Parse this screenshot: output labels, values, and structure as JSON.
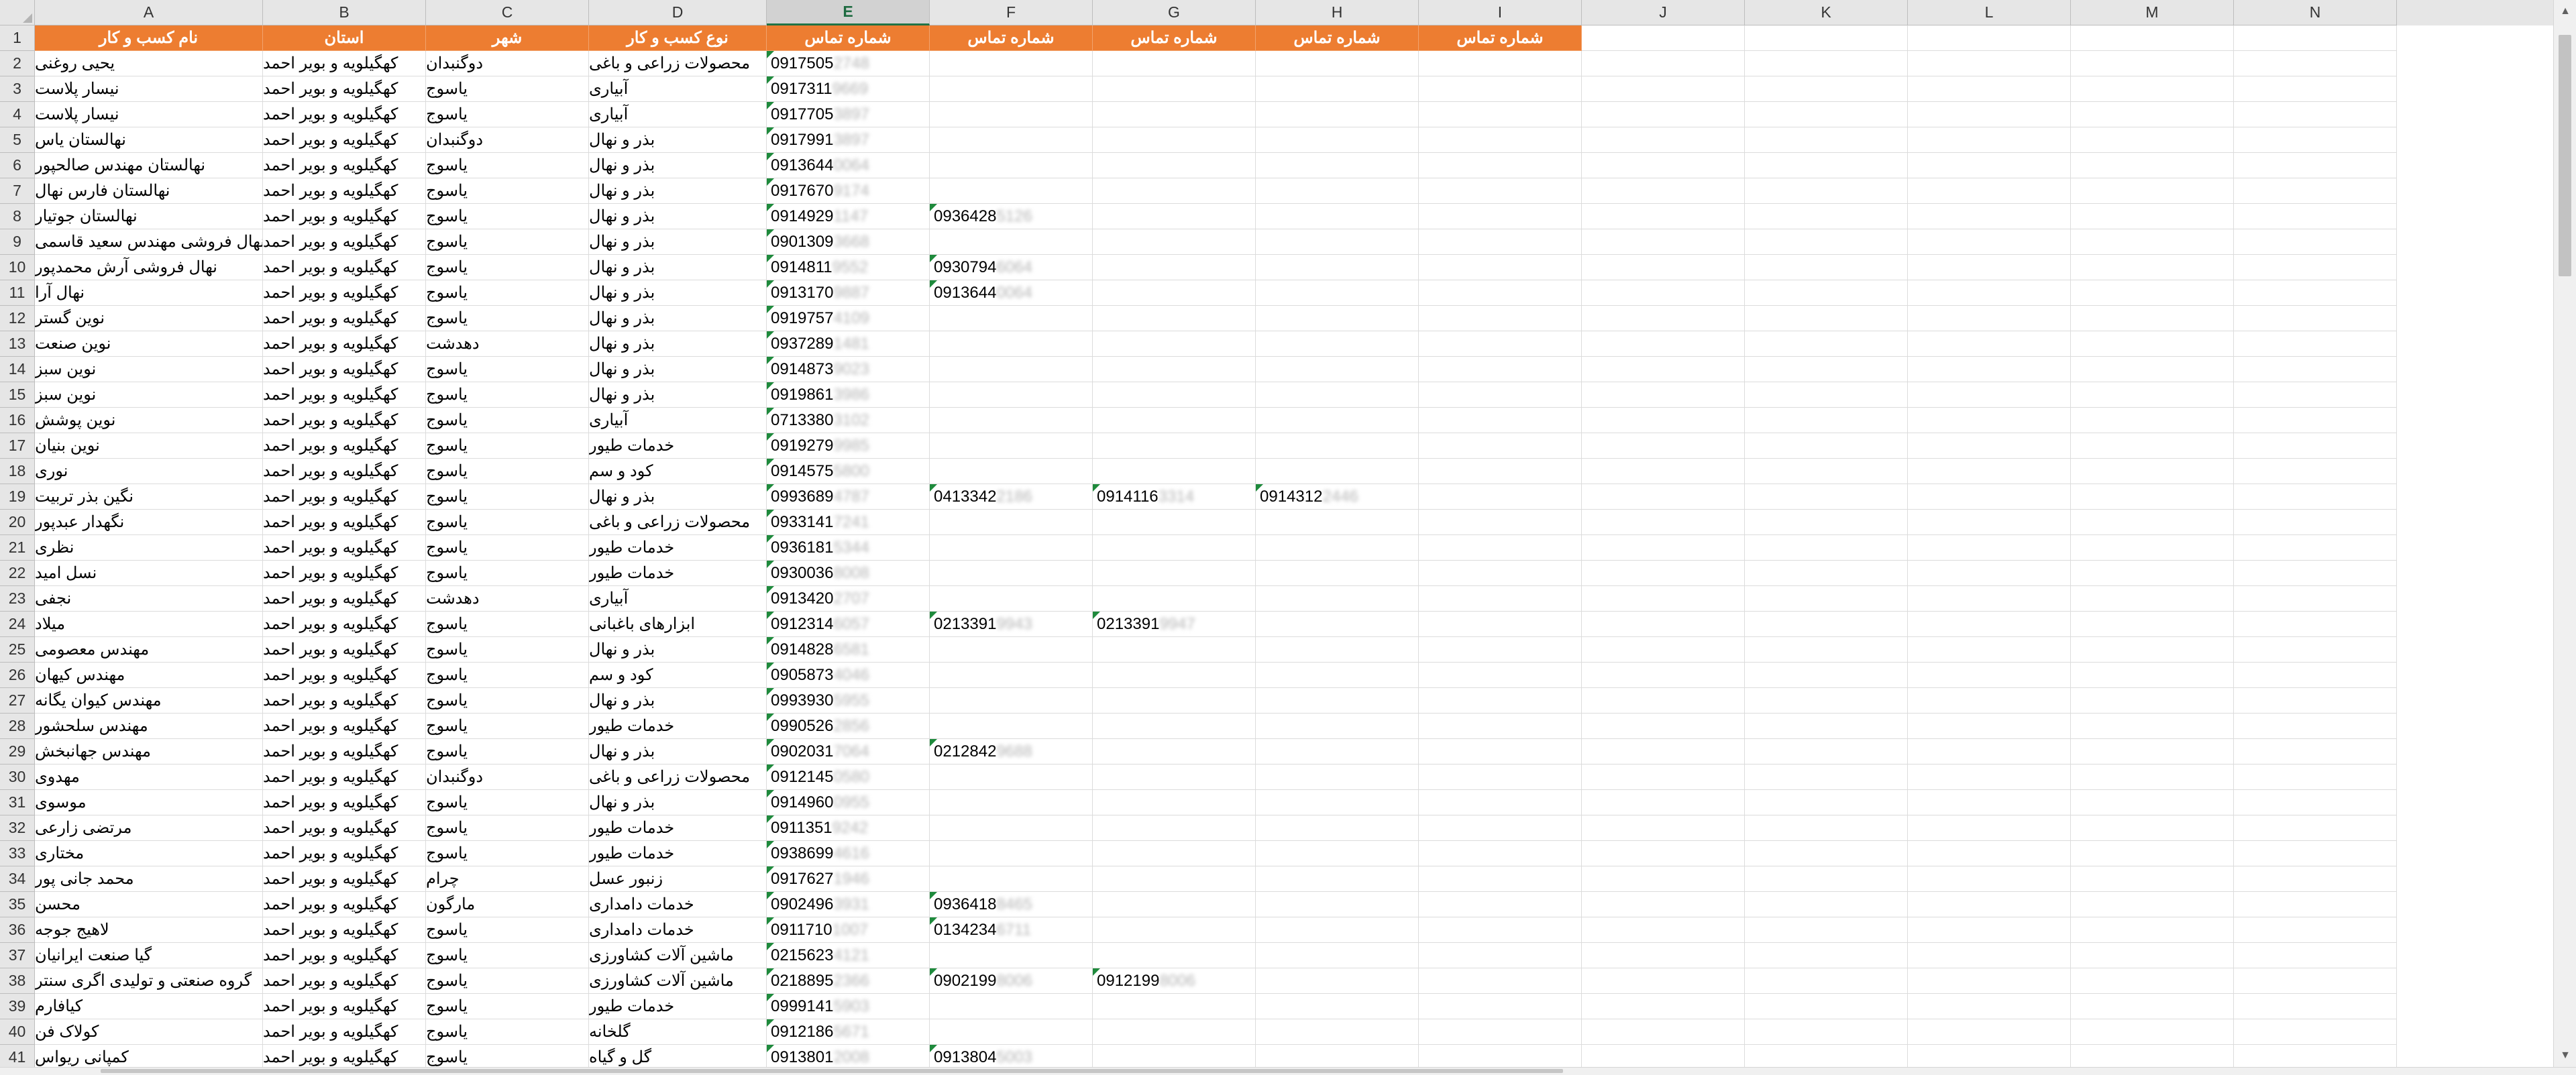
{
  "sheet": {
    "column_letters": [
      "A",
      "B",
      "C",
      "D",
      "E",
      "F",
      "G",
      "H",
      "I",
      "J",
      "K",
      "L",
      "M",
      "N"
    ],
    "selected_column": "E",
    "header_row": [
      "نام کسب و کار",
      "استان",
      "شهر",
      "نوع کسب و کار",
      "شماره تماس",
      "شماره تماس",
      "شماره تماس",
      "شماره تماس",
      "شماره تماس"
    ],
    "rows": [
      {
        "n": "2",
        "a": "یحیی روغنی",
        "b": "کهگیلویه و بویر احمد",
        "c": "دوگنبدان",
        "d": "محصولات زراعی و باغی",
        "e": "0917505",
        "eb": "2748",
        "f": "",
        "fb": "",
        "g": "",
        "gb": "",
        "h": "",
        "hb": ""
      },
      {
        "n": "3",
        "a": "نیسار پلاست",
        "b": "کهگیلویه و بویر احمد",
        "c": "یاسوج",
        "d": "آبیاری",
        "e": "0917311",
        "eb": "9669",
        "f": "",
        "fb": "",
        "g": "",
        "gb": "",
        "h": "",
        "hb": ""
      },
      {
        "n": "4",
        "a": "نیسار پلاست",
        "b": "کهگیلویه و بویر احمد",
        "c": "یاسوج",
        "d": "آبیاری",
        "e": "0917705",
        "eb": "3897",
        "f": "",
        "fb": "",
        "g": "",
        "gb": "",
        "h": "",
        "hb": ""
      },
      {
        "n": "5",
        "a": "نهالستان یاس",
        "b": "کهگیلویه و بویر احمد",
        "c": "دوگنبدان",
        "d": "بذر و نهال",
        "e": "0917991",
        "eb": "3897",
        "f": "",
        "fb": "",
        "g": "",
        "gb": "",
        "h": "",
        "hb": ""
      },
      {
        "n": "6",
        "a": "نهالستان مهندس صالحپور",
        "b": "کهگیلویه و بویر احمد",
        "c": "یاسوج",
        "d": "بذر و نهال",
        "e": "0913644",
        "eb": "0064",
        "f": "",
        "fb": "",
        "g": "",
        "gb": "",
        "h": "",
        "hb": ""
      },
      {
        "n": "7",
        "a": "نهالستان فارس نهال",
        "b": "کهگیلویه و بویر احمد",
        "c": "یاسوج",
        "d": "بذر و نهال",
        "e": "0917670",
        "eb": "9174",
        "f": "",
        "fb": "",
        "g": "",
        "gb": "",
        "h": "",
        "hb": ""
      },
      {
        "n": "8",
        "a": "نهالستان جوتیار",
        "b": "کهگیلویه و بویر احمد",
        "c": "یاسوج",
        "d": "بذر و نهال",
        "e": "0914929",
        "eb": "1147",
        "f": "0936428",
        "fb": "5126",
        "g": "",
        "gb": "",
        "h": "",
        "hb": ""
      },
      {
        "n": "9",
        "a": "نهالستان پالیز و نهال فروشی مهندس سعید قاسمی",
        "b": "کهگیلویه و بویر احمد",
        "c": "یاسوج",
        "d": "بذر و نهال",
        "e": "0901309",
        "eb": "3668",
        "f": "",
        "fb": "",
        "g": "",
        "gb": "",
        "h": "",
        "hb": ""
      },
      {
        "n": "10",
        "a": "نهال فروشی آرش محمدپور",
        "b": "کهگیلویه و بویر احمد",
        "c": "یاسوج",
        "d": "بذر و نهال",
        "e": "0914811",
        "eb": "9552",
        "f": "0930794",
        "fb": "6064",
        "g": "",
        "gb": "",
        "h": "",
        "hb": ""
      },
      {
        "n": "11",
        "a": "نهال آرا",
        "b": "کهگیلویه و بویر احمد",
        "c": "یاسوج",
        "d": "بذر و نهال",
        "e": "0913170",
        "eb": "9887",
        "f": "0913644",
        "fb": "0064",
        "g": "",
        "gb": "",
        "h": "",
        "hb": ""
      },
      {
        "n": "12",
        "a": "نوین گستر",
        "b": "کهگیلویه و بویر احمد",
        "c": "یاسوج",
        "d": "بذر و نهال",
        "e": "0919757",
        "eb": "4109",
        "f": "",
        "fb": "",
        "g": "",
        "gb": "",
        "h": "",
        "hb": ""
      },
      {
        "n": "13",
        "a": "نوین صنعت",
        "b": "کهگیلویه و بویر احمد",
        "c": "دهدشت",
        "d": "بذر و نهال",
        "e": "0937289",
        "eb": "1481",
        "f": "",
        "fb": "",
        "g": "",
        "gb": "",
        "h": "",
        "hb": ""
      },
      {
        "n": "14",
        "a": "نوین سبز",
        "b": "کهگیلویه و بویر احمد",
        "c": "یاسوج",
        "d": "بذر و نهال",
        "e": "0914873",
        "eb": "9023",
        "f": "",
        "fb": "",
        "g": "",
        "gb": "",
        "h": "",
        "hb": ""
      },
      {
        "n": "15",
        "a": "نوین سبز",
        "b": "کهگیلویه و بویر احمد",
        "c": "یاسوج",
        "d": "بذر و نهال",
        "e": "0919861",
        "eb": "3986",
        "f": "",
        "fb": "",
        "g": "",
        "gb": "",
        "h": "",
        "hb": ""
      },
      {
        "n": "16",
        "a": "نوین پوشش",
        "b": "کهگیلویه و بویر احمد",
        "c": "یاسوج",
        "d": "آبیاری",
        "e": "0713380",
        "eb": "3102",
        "f": "",
        "fb": "",
        "g": "",
        "gb": "",
        "h": "",
        "hb": ""
      },
      {
        "n": "17",
        "a": "نوین بنیان",
        "b": "کهگیلویه و بویر احمد",
        "c": "یاسوج",
        "d": "خدمات طیور",
        "e": "0919279",
        "eb": "9985",
        "f": "",
        "fb": "",
        "g": "",
        "gb": "",
        "h": "",
        "hb": ""
      },
      {
        "n": "18",
        "a": "نوری",
        "b": "کهگیلویه و بویر احمد",
        "c": "یاسوج",
        "d": "کود و سم",
        "e": "0914575",
        "eb": "5800",
        "f": "",
        "fb": "",
        "g": "",
        "gb": "",
        "h": "",
        "hb": ""
      },
      {
        "n": "19",
        "a": "نگین بذر تربیت",
        "b": "کهگیلویه و بویر احمد",
        "c": "یاسوج",
        "d": "بذر و نهال",
        "e": "0993689",
        "eb": "4787",
        "f": "0413342",
        "fb": "2186",
        "g": "0914116",
        "gb": "3314",
        "h": "0914312",
        "hb": "2446"
      },
      {
        "n": "20",
        "a": "نگهدار عبدپور",
        "b": "کهگیلویه و بویر احمد",
        "c": "یاسوج",
        "d": "محصولات زراعی و باغی",
        "e": "0933141",
        "eb": "7241",
        "f": "",
        "fb": "",
        "g": "",
        "gb": "",
        "h": "",
        "hb": ""
      },
      {
        "n": "21",
        "a": "نظری",
        "b": "کهگیلویه و بویر احمد",
        "c": "یاسوج",
        "d": "خدمات طیور",
        "e": "0936181",
        "eb": "5344",
        "f": "",
        "fb": "",
        "g": "",
        "gb": "",
        "h": "",
        "hb": ""
      },
      {
        "n": "22",
        "a": "نسل امید",
        "b": "کهگیلویه و بویر احمد",
        "c": "یاسوج",
        "d": "خدمات طیور",
        "e": "0930036",
        "eb": "8008",
        "f": "",
        "fb": "",
        "g": "",
        "gb": "",
        "h": "",
        "hb": ""
      },
      {
        "n": "23",
        "a": "نجفی",
        "b": "کهگیلویه و بویر احمد",
        "c": "دهدشت",
        "d": "آبیاری",
        "e": "0913420",
        "eb": "2707",
        "f": "",
        "fb": "",
        "g": "",
        "gb": "",
        "h": "",
        "hb": ""
      },
      {
        "n": "24",
        "a": "میلاد",
        "b": "کهگیلویه و بویر احمد",
        "c": "یاسوج",
        "d": "ابزارهای باغبانی",
        "e": "0912314",
        "eb": "6057",
        "f": "0213391",
        "fb": "9943",
        "g": "0213391",
        "gb": "9947",
        "h": "",
        "hb": ""
      },
      {
        "n": "25",
        "a": "مهندس معصومی",
        "b": "کهگیلویه و بویر احمد",
        "c": "یاسوج",
        "d": "بذر و نهال",
        "e": "0914828",
        "eb": "6581",
        "f": "",
        "fb": "",
        "g": "",
        "gb": "",
        "h": "",
        "hb": ""
      },
      {
        "n": "26",
        "a": "مهندس کیهان",
        "b": "کهگیلویه و بویر احمد",
        "c": "یاسوج",
        "d": "کود و سم",
        "e": "0905873",
        "eb": "4046",
        "f": "",
        "fb": "",
        "g": "",
        "gb": "",
        "h": "",
        "hb": ""
      },
      {
        "n": "27",
        "a": "مهندس کیوان یگانه",
        "b": "کهگیلویه و بویر احمد",
        "c": "یاسوج",
        "d": "بذر و نهال",
        "e": "0993930",
        "eb": "5955",
        "f": "",
        "fb": "",
        "g": "",
        "gb": "",
        "h": "",
        "hb": ""
      },
      {
        "n": "28",
        "a": "مهندس سلحشور",
        "b": "کهگیلویه و بویر احمد",
        "c": "یاسوج",
        "d": "خدمات طیور",
        "e": "0990526",
        "eb": "2856",
        "f": "",
        "fb": "",
        "g": "",
        "gb": "",
        "h": "",
        "hb": ""
      },
      {
        "n": "29",
        "a": "مهندس جهانبخش",
        "b": "کهگیلویه و بویر احمد",
        "c": "یاسوج",
        "d": "بذر و نهال",
        "e": "0902031",
        "eb": "7064",
        "f": "0212842",
        "fb": "9688",
        "g": "",
        "gb": "",
        "h": "",
        "hb": ""
      },
      {
        "n": "30",
        "a": "مهدوی",
        "b": "کهگیلویه و بویر احمد",
        "c": "دوگنبدان",
        "d": "محصولات زراعی و باغی",
        "e": "0912145",
        "eb": "0580",
        "f": "",
        "fb": "",
        "g": "",
        "gb": "",
        "h": "",
        "hb": ""
      },
      {
        "n": "31",
        "a": "موسوی",
        "b": "کهگیلویه و بویر احمد",
        "c": "یاسوج",
        "d": "بذر و نهال",
        "e": "0914960",
        "eb": "0955",
        "f": "",
        "fb": "",
        "g": "",
        "gb": "",
        "h": "",
        "hb": ""
      },
      {
        "n": "32",
        "a": "مرتضی زارعی",
        "b": "کهگیلویه و بویر احمد",
        "c": "یاسوج",
        "d": "خدمات طیور",
        "e": "0911351",
        "eb": "9242",
        "f": "",
        "fb": "",
        "g": "",
        "gb": "",
        "h": "",
        "hb": ""
      },
      {
        "n": "33",
        "a": "مختاری",
        "b": "کهگیلویه و بویر احمد",
        "c": "یاسوج",
        "d": "خدمات طیور",
        "e": "0938699",
        "eb": "4616",
        "f": "",
        "fb": "",
        "g": "",
        "gb": "",
        "h": "",
        "hb": ""
      },
      {
        "n": "34",
        "a": "محمد جانی پور",
        "b": "کهگیلویه و بویر احمد",
        "c": "چرام",
        "d": "زنبور عسل",
        "e": "0917627",
        "eb": "1946",
        "f": "",
        "fb": "",
        "g": "",
        "gb": "",
        "h": "",
        "hb": ""
      },
      {
        "n": "35",
        "a": "محسن",
        "b": "کهگیلویه و بویر احمد",
        "c": "مارگون",
        "d": "خدمات دامداری",
        "e": "0902496",
        "eb": "3931",
        "f": "0936418",
        "fb": "8465",
        "g": "",
        "gb": "",
        "h": "",
        "hb": ""
      },
      {
        "n": "36",
        "a": "لاهیج جوجه",
        "b": "کهگیلویه و بویر احمد",
        "c": "یاسوج",
        "d": "خدمات دامداری",
        "e": "0911710",
        "eb": "1007",
        "f": "0134234",
        "fb": "6711",
        "g": "",
        "gb": "",
        "h": "",
        "hb": ""
      },
      {
        "n": "37",
        "a": "گیا صنعت ایرانیان",
        "b": "کهگیلویه و بویر احمد",
        "c": "یاسوج",
        "d": "ماشین آلات کشاورزی",
        "e": "0215623",
        "eb": "4121",
        "f": "",
        "fb": "",
        "g": "",
        "gb": "",
        "h": "",
        "hb": ""
      },
      {
        "n": "38",
        "a": "گروه صنعتی و تولیدی اگری سنتر",
        "b": "کهگیلویه و بویر احمد",
        "c": "یاسوج",
        "d": "ماشین آلات کشاورزی",
        "e": "0218895",
        "eb": "2366",
        "f": "0902199",
        "fb": "8006",
        "g": "0912199",
        "gb": "8006",
        "h": "",
        "hb": ""
      },
      {
        "n": "39",
        "a": "کیافارم",
        "b": "کهگیلویه و بویر احمد",
        "c": "یاسوج",
        "d": "خدمات طیور",
        "e": "0999141",
        "eb": "5903",
        "f": "",
        "fb": "",
        "g": "",
        "gb": "",
        "h": "",
        "hb": ""
      },
      {
        "n": "40",
        "a": "کولاک فن",
        "b": "کهگیلویه و بویر احمد",
        "c": "یاسوج",
        "d": "گلخانه",
        "e": "0912186",
        "eb": "5671",
        "f": "",
        "fb": "",
        "g": "",
        "gb": "",
        "h": "",
        "hb": ""
      },
      {
        "n": "41",
        "a": "کمپانی ریواس",
        "b": "کهگیلویه و بویر احمد",
        "c": "یاسوج",
        "d": "گل و گیاه",
        "e": "0913801",
        "eb": "2008",
        "f": "0913804",
        "fb": "5003",
        "g": "",
        "gb": "",
        "h": "",
        "hb": ""
      }
    ]
  },
  "scrollbar": {
    "up_glyph": "▲",
    "down_glyph": "▼"
  }
}
